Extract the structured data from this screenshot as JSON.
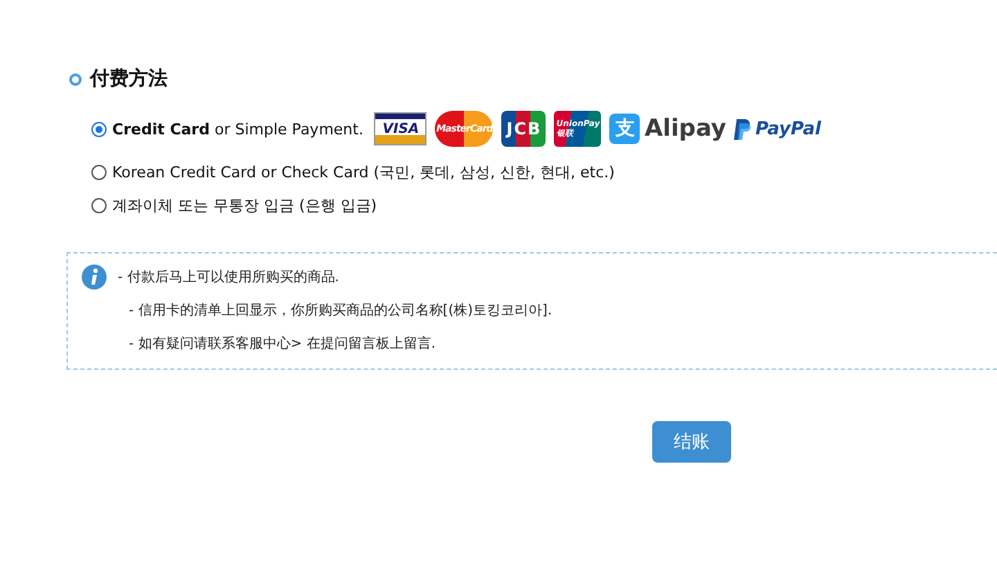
{
  "section": {
    "title": "付费方法"
  },
  "options": [
    {
      "label": "**Credit Card** or Simple Payment.",
      "selected": true,
      "logos": [
        {
          "kind": "visa",
          "label": "VISA"
        },
        {
          "kind": "mastercard",
          "label": "MasterCard"
        },
        {
          "kind": "jcb",
          "label": "JCB"
        },
        {
          "kind": "unionpay",
          "label": "UnionPay",
          "sublabel": "银联"
        },
        {
          "kind": "alipay",
          "label": "Alipay",
          "sublabel": "支"
        },
        {
          "kind": "paypal",
          "label": "PayPal"
        }
      ]
    },
    {
      "label": "Korean Credit Card or Check Card (국민, 롯데, 삼성, 신한, 현대, etc.)",
      "selected": false
    },
    {
      "label": "계좌이체 또는 무통장 입금 (은행 입금)",
      "selected": false
    }
  ],
  "notice": {
    "lines": [
      "- 付款后马上可以使用所购买的商品.",
      "- 信用卡的清单上回显示，你所购买商品的公司名称[(株)토킹코리아].",
      "- 如有疑问请联系客服中心> 在提问留言板上留言."
    ]
  },
  "checkout_button": "结账"
}
